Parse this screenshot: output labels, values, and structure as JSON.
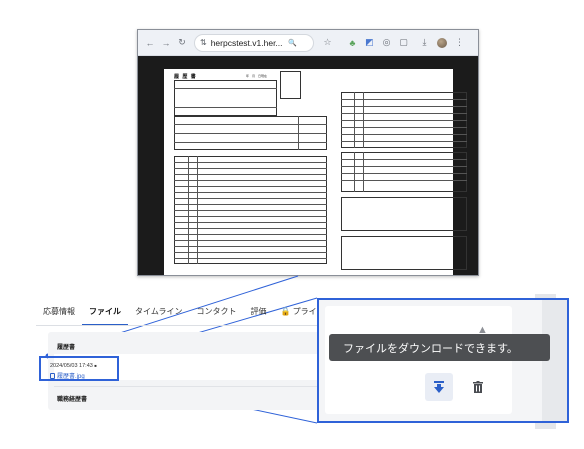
{
  "browser": {
    "url": "herpcstest.v1.her...",
    "icons": [
      "back-arrow-icon",
      "forward-arrow-icon",
      "reload-icon",
      "site-settings-icon",
      "zoom-icon",
      "bookmark-star-icon",
      "extension-icon",
      "extension-icon",
      "extension-icon",
      "extensions-puzzle-icon",
      "download-icon",
      "profile-avatar",
      "menu-kebab-icon"
    ],
    "glyphs": {
      "back": "←",
      "forward": "→",
      "reload": "↻",
      "tune": "⇅",
      "zoom": "🔍",
      "star": "☆",
      "ext1": "♣",
      "ext2": "◩",
      "ext3": "◎",
      "puzzle": "▢",
      "download": "⤓",
      "menu": "⋮"
    }
  },
  "resume_preview": {
    "title": "履 歴 書",
    "date": "年　月　日現在"
  },
  "tabs": [
    {
      "label": "応募情報",
      "active": false
    },
    {
      "label": "ファイル",
      "active": true
    },
    {
      "label": "タイムライン",
      "active": false
    },
    {
      "label": "コンタクト",
      "active": false
    },
    {
      "label": "評価",
      "active": false
    },
    {
      "label": "🔒 プライベ",
      "active": false
    }
  ],
  "files": {
    "section_resume": "履歴書",
    "uploaded_at": "2024/05/03 17:43",
    "new_badge": "■",
    "file_name": "履歴書.jpg",
    "section_career": "職務経歴書"
  },
  "zoom": {
    "tooltip": "ファイルをダウンロードできます。",
    "up_arrow": "▲",
    "download_glyph": "↧",
    "trash_glyph": "🗑"
  },
  "colors": {
    "accent": "#2f62d8",
    "tooltip_bg": "#4d4f52",
    "link": "#2b5fc8"
  }
}
